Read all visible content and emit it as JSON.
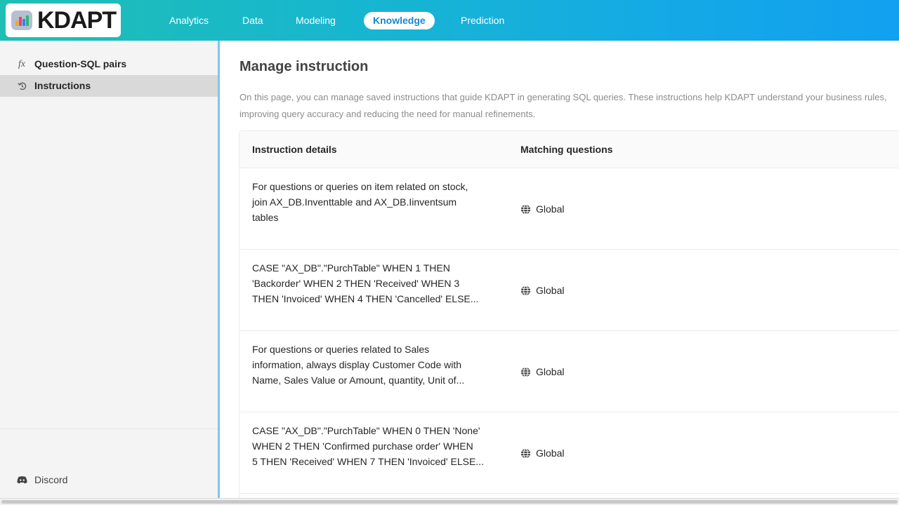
{
  "header": {
    "logo_text": "KDAPT",
    "nav": [
      "Analytics",
      "Data",
      "Modeling",
      "Knowledge",
      "Prediction"
    ],
    "active_nav": "Knowledge"
  },
  "sidebar": {
    "items": [
      {
        "label": "Question-SQL pairs",
        "icon": "fx-icon"
      },
      {
        "label": "Instructions",
        "icon": "instructions-icon",
        "active": true
      }
    ],
    "footer": {
      "label": "Discord",
      "icon": "discord-icon"
    }
  },
  "main": {
    "title": "Manage instruction",
    "description": "On this page, you can manage saved instructions that guide KDAPT in generating SQL queries. These instructions help KDAPT understand your business rules, improving query accuracy and reducing the need for manual refinements.",
    "table": {
      "columns": [
        "Instruction details",
        "Matching questions"
      ],
      "rows": [
        {
          "lines": [
            "For questions or queries on item related on stock,",
            "join AX_DB.Inventtable and AX_DB.Iinventsum",
            "tables"
          ],
          "matching": "Global"
        },
        {
          "lines": [
            "CASE \"AX_DB\".\"PurchTable\" WHEN 1 THEN",
            "'Backorder' WHEN 2 THEN 'Received' WHEN 3",
            "THEN 'Invoiced' WHEN 4 THEN 'Cancelled' ELSE..."
          ],
          "matching": "Global"
        },
        {
          "lines": [
            "For questions or queries related to Sales",
            "information, always display Customer Code with",
            "Name, Sales Value or Amount, quantity, Unit of..."
          ],
          "matching": "Global"
        },
        {
          "lines": [
            "CASE \"AX_DB\".\"PurchTable\" WHEN 0 THEN 'None'",
            "WHEN 2 THEN 'Confirmed purchase order' WHEN",
            "5 THEN 'Received' WHEN 7 THEN 'Invoiced' ELSE..."
          ],
          "matching": "Global"
        }
      ]
    }
  },
  "colors": {
    "header_start": "#1fbfb4",
    "header_end": "#12a0f0",
    "active_nav_text": "#1589d0",
    "sidebar_bg": "#f4f4f4",
    "sidebar_active_bg": "#d9d9d9"
  }
}
